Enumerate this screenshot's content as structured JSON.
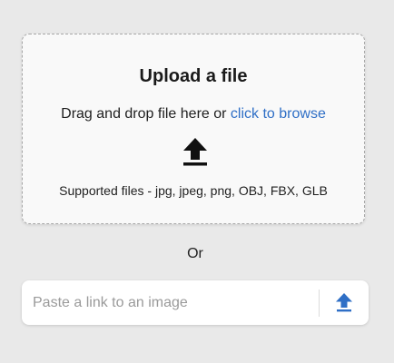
{
  "dropzone": {
    "title": "Upload a file",
    "drag_text": "Drag and drop file here or ",
    "browse_link": "click to browse",
    "supported_text": "Supported files - jpg, jpeg, png, OBJ, FBX, GLB",
    "icon": "upload-icon"
  },
  "separator": {
    "label": "Or"
  },
  "link_input": {
    "placeholder": "Paste a link to an image",
    "value": "",
    "button_icon": "upload-icon"
  },
  "colors": {
    "background": "#e9e9e9",
    "dropzone_bg": "#f9f9f9",
    "link": "#2f6fc6",
    "icon_dark": "#111111",
    "icon_accent": "#2f6fc6"
  }
}
